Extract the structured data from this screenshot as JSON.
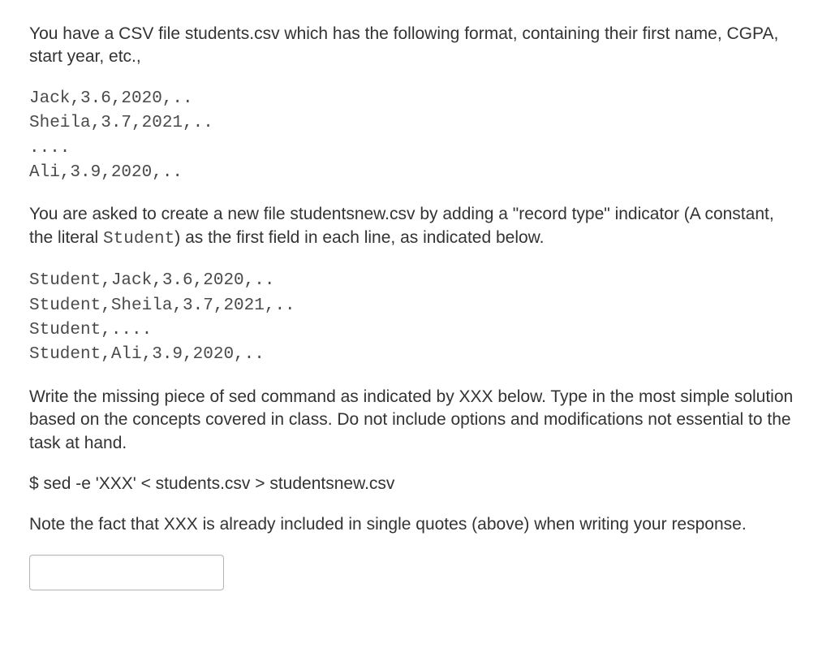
{
  "paragraphs": {
    "p1": "You have a CSV file students.csv which has the following format, containing their first name, CGPA, start year, etc.,",
    "code1_lines": [
      "Jack,3.6,2020,..",
      "Sheila,3.7,2021,..",
      "....",
      "Ali,3.9,2020,.."
    ],
    "p2_pre": "You are asked to create a new file studentsnew.csv by adding a \"record type\" indicator (A constant, the literal ",
    "p2_code": "Student",
    "p2_post": ") as the first field in each line, as indicated below.",
    "code2_lines": [
      "Student,Jack,3.6,2020,..",
      "Student,Sheila,3.7,2021,..",
      "Student,....",
      "Student,Ali,3.9,2020,.."
    ],
    "p3": "Write the missing piece of sed command as indicated by XXX below. Type in the most simple solution based on the concepts covered in class. Do not include options and modifications not essential to the task at hand.",
    "p4": "$ sed -e 'XXX' < students.csv > studentsnew.csv",
    "p5": "Note the fact that XXX is already included in single quotes (above) when writing your response."
  },
  "input": {
    "value": "",
    "placeholder": ""
  }
}
